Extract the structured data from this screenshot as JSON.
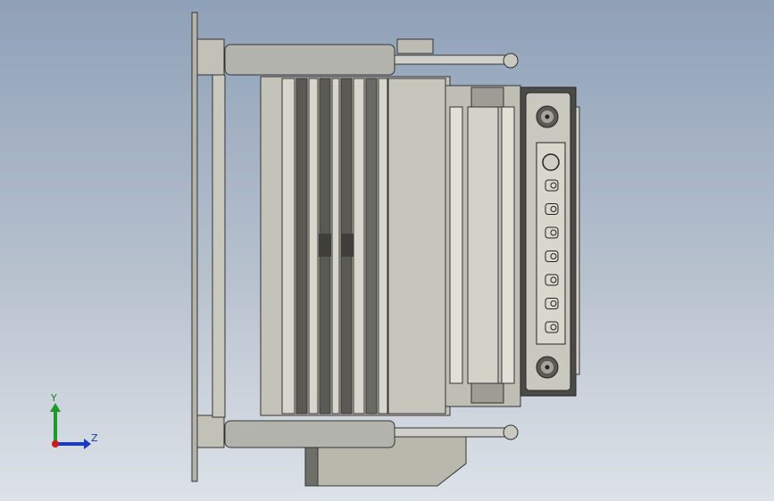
{
  "view": {
    "background_top": "#8fa1b8",
    "background_bottom": "#dde2e8"
  },
  "model": {
    "body_color": "#c8c7bd",
    "steel_color": "#a9a9a4",
    "dark_color": "#3a3a3a",
    "panel_buttons": 7
  },
  "triad": {
    "y_label": "Y",
    "z_label": "Z",
    "y_color": "#1c9a2b",
    "z_color": "#1a3bbf",
    "x_color": "#cc1a1a"
  }
}
